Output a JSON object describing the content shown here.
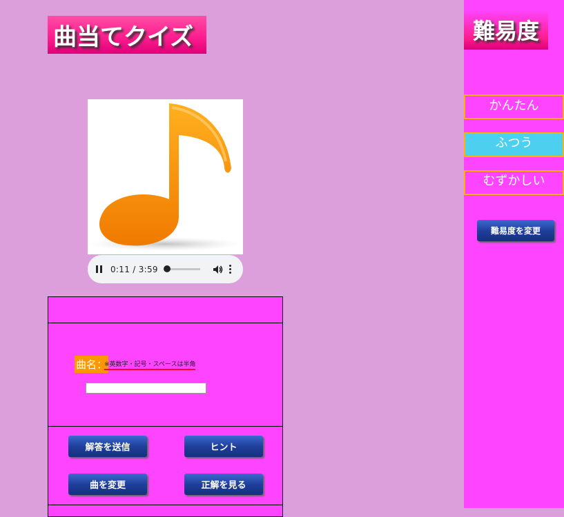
{
  "header": {
    "title": "曲当てクイズ"
  },
  "sidebar": {
    "title": "難易度",
    "levels": [
      {
        "label": "かんたん",
        "active": false
      },
      {
        "label": "ふつう",
        "active": true
      },
      {
        "label": "むずかしい",
        "active": false
      }
    ],
    "change_button": "難易度を変更"
  },
  "player": {
    "current_time": "0:11",
    "duration": "3:59",
    "time_display": "0:11 / 3:59",
    "progress": 0.05,
    "icons": [
      "pause-icon",
      "volume-icon",
      "more-icon",
      "music-note-icon"
    ]
  },
  "quiz": {
    "answer_label": "曲名：",
    "answer_note": "※英数字・記号・スペースは半角",
    "answer_value": "",
    "buttons": {
      "submit": "解答を送信",
      "hint": "ヒント",
      "change_song": "曲を変更",
      "show_answer": "正解を見る"
    }
  },
  "colors": {
    "background": "#dc9fdc",
    "panel": "#ff44ff",
    "title_banner": "#ff1f8f",
    "active_level": "#4dd0f0",
    "button": "#1f3f9c",
    "label_accent": "#ff9800"
  }
}
